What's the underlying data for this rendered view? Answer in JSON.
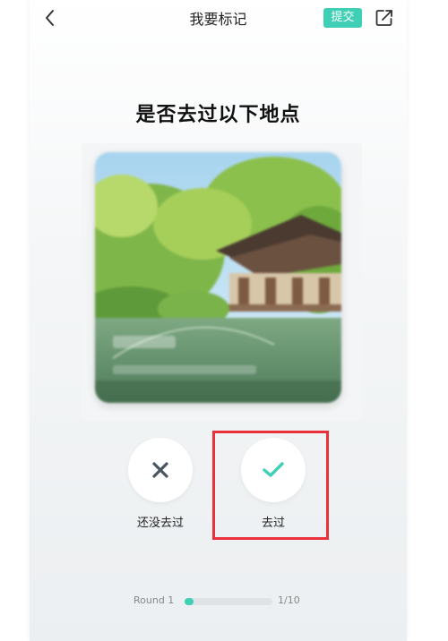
{
  "header": {
    "title": "我要标记",
    "submit_label": "提交",
    "back_icon": "chevron-left-icon",
    "share_icon": "share-icon"
  },
  "main": {
    "question": "是否去过以下地点",
    "card": {
      "image": "blurred photo of a Chinese pavilion by a pond with greenery"
    },
    "actions": {
      "not_been_label": "还没去过",
      "been_label": "去过"
    }
  },
  "progress": {
    "round_label": "Round 1",
    "count_label": "1/10",
    "value": 0.1
  },
  "colors": {
    "accent": "#3fcfb4",
    "highlight": "#e8313b",
    "icon_dark": "#4a5560"
  }
}
